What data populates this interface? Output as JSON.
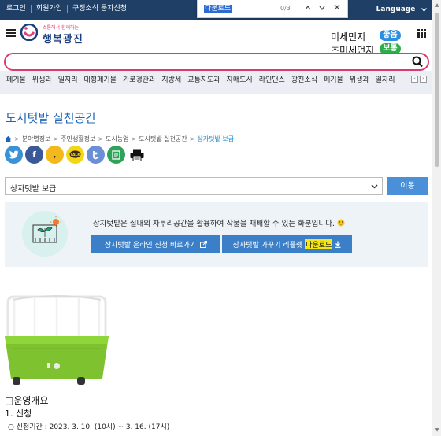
{
  "topbar": {
    "links": [
      "로그인",
      "회원가입",
      "구정소식 문자신청"
    ],
    "language": "Language"
  },
  "findbar": {
    "query": "다운로드",
    "count": "0/3"
  },
  "header": {
    "logo_tagline": "소통해서 함께하는",
    "logo_name": "행복광진",
    "dust_label": "미세먼지",
    "dust_value": "좋음",
    "ultra_dust_label": "초미세먼지",
    "ultra_dust_value": "보통",
    "colors": {
      "good": "#2b8ee0",
      "normal": "#2eae4a",
      "brand": "#d83b6f"
    }
  },
  "search": {
    "value": ""
  },
  "keywords": [
    "폐기물",
    "위생과",
    "일자리",
    "대형폐기물",
    "가로경관과",
    "지방세",
    "교통지도과",
    "자매도시",
    "라인댄스",
    "광진소식",
    "폐기물",
    "위생과",
    "일자리"
  ],
  "page": {
    "title": "도시텃밭 실천공간",
    "breadcrumb": [
      "분야별정보",
      "주민생활정보",
      "도시농업",
      "도시텃밭 실천공간",
      "상자텃밭 보급"
    ],
    "share_icons": [
      "twitter-icon",
      "facebook-icon",
      "kakaostory-icon",
      "kakaotalk-icon",
      "band-icon",
      "naverblog-icon",
      "print-icon"
    ]
  },
  "select": {
    "value": "상자텃밭 보급",
    "go_label": "이동"
  },
  "info": {
    "description": "상자텃밭은 실내외 자투리공간을 활용하여 작물을 재배할 수 있는 화분입니다.",
    "btn_apply": "상자텃밭 온라인 신청 바로가기",
    "btn_leaflet_prefix": "상자텃밭 가꾸기 리플렛",
    "btn_leaflet_highlight": "다운로드"
  },
  "content": {
    "section_title": "□운영개요",
    "sub_title": "1. 신청",
    "period": "○ 신청기간 : 2023. 3. 10. (10시) ~ 3. 16. (17시)"
  }
}
